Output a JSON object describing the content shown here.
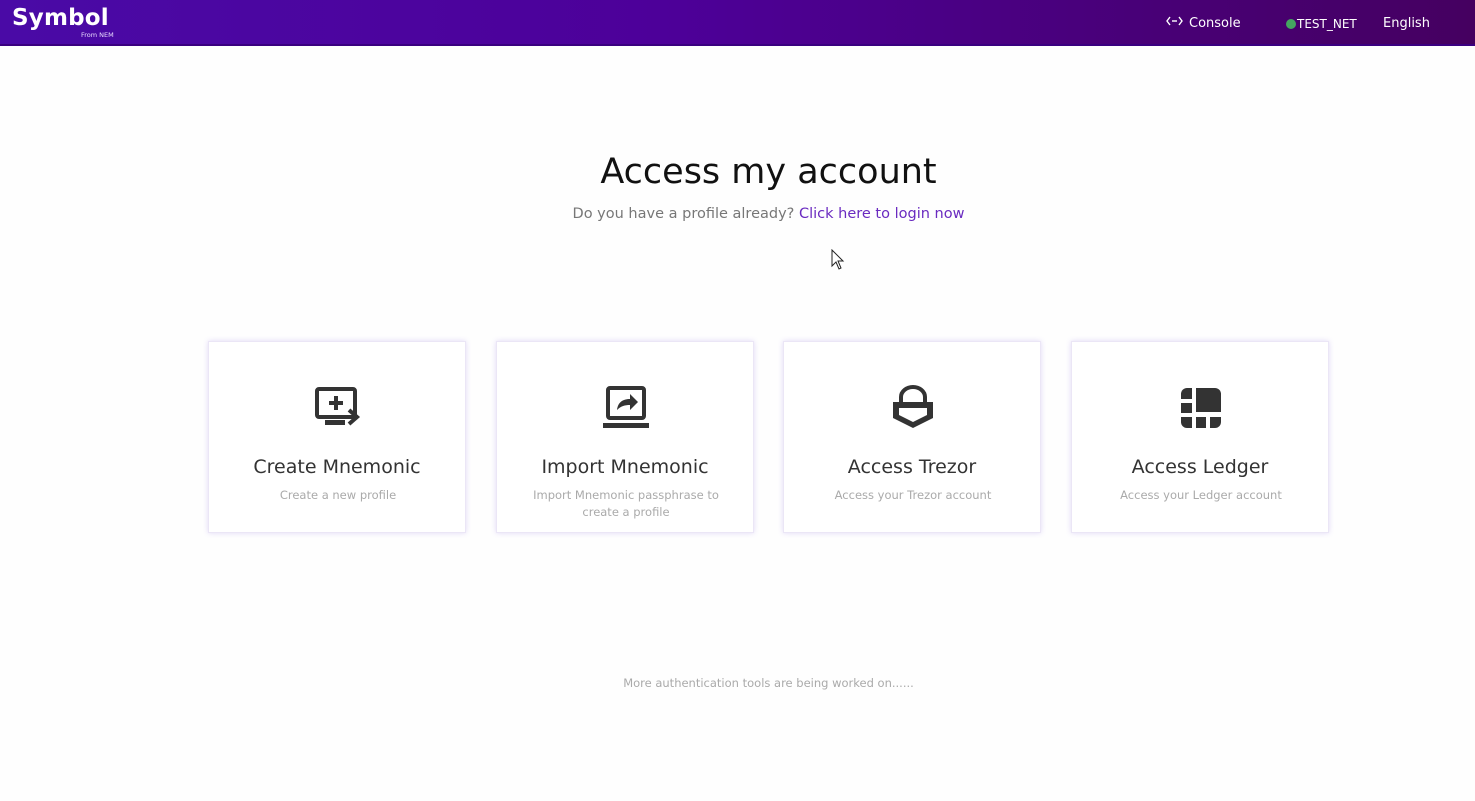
{
  "header": {
    "logo_text": "Symbol",
    "logo_subtext": "From NEM",
    "console_label": "Console",
    "console_icon": "code-arrows-icon",
    "network_label": "TEST_NET",
    "network_status_color": "#44a660",
    "language_label": "English"
  },
  "main": {
    "title": "Access my account",
    "subtitle_prefix": "Do you have a profile already?",
    "login_link": "Click here to login now",
    "cards": [
      {
        "title": "Create Mnemonic",
        "description": "Create a new profile",
        "icon": "monitor-plus-icon"
      },
      {
        "title": "Import Mnemonic",
        "description": "Import Mnemonic passphrase to create a profile",
        "icon": "laptop-share-icon"
      },
      {
        "title": "Access Trezor",
        "description": "Access your Trezor account",
        "icon": "trezor-shield-icon"
      },
      {
        "title": "Access Ledger",
        "description": "Access your Ledger account",
        "icon": "ledger-grid-icon"
      }
    ],
    "footer_note": "More authentication tools are being worked on......"
  },
  "colors": {
    "header_gradient_start": "#4a0aa6",
    "header_gradient_end": "#450060",
    "link": "#6a2bc0",
    "icon": "#333333"
  }
}
